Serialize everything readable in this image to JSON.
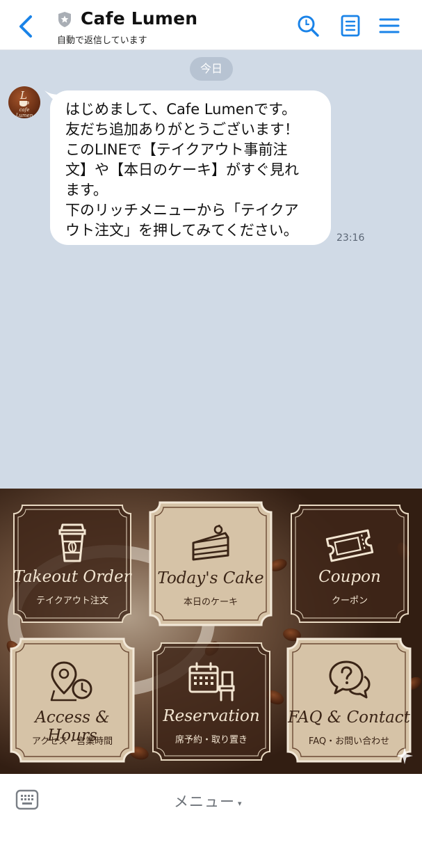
{
  "header": {
    "title": "Cafe Lumen",
    "subtitle": "自動で返信しています"
  },
  "chat": {
    "date_label": "今日",
    "avatar": {
      "monogram": "L",
      "name": "cafe Lumen"
    },
    "messages": [
      {
        "text": "はじめまして、Cafe Lumenです。\n友だち追加ありがとうございます！\nこのLINEで【テイクアウト事前注\n文】や【本日のケーキ】がすぐ見れ\nます。\n下のリッチメニューから「テイクア\nウト注文」を押してみてください。",
        "time": "23:16"
      }
    ]
  },
  "rich_menu": {
    "colors": {
      "tile_light": "#d6c3a7",
      "tile_dark": "#3f2619",
      "ink": "#3a2416",
      "cream": "#f3e6d2"
    },
    "tiles": [
      {
        "en": "Takeout Order",
        "ja": "テイクアウト注文",
        "icon": "coffee-cup-icon",
        "style": "dark"
      },
      {
        "en": "Today's Cake",
        "ja": "本日のケーキ",
        "icon": "cake-slice-icon",
        "style": "light"
      },
      {
        "en": "Coupon",
        "ja": "クーポン",
        "icon": "ticket-icon",
        "style": "dark"
      },
      {
        "en": "Access & Hours",
        "ja": "アクセス・営業時間",
        "icon": "map-pin-clock-icon",
        "style": "light"
      },
      {
        "en": "Reservation",
        "ja": "席予約・取り置き",
        "icon": "calendar-chair-icon",
        "style": "dark"
      },
      {
        "en": "FAQ & Contact",
        "ja": "FAQ・お問い合わせ",
        "icon": "question-chat-icon",
        "style": "light"
      }
    ]
  },
  "bottom_bar": {
    "menu_label": "メニュー",
    "caret": "▾"
  },
  "accent_color": "#1a83e8"
}
